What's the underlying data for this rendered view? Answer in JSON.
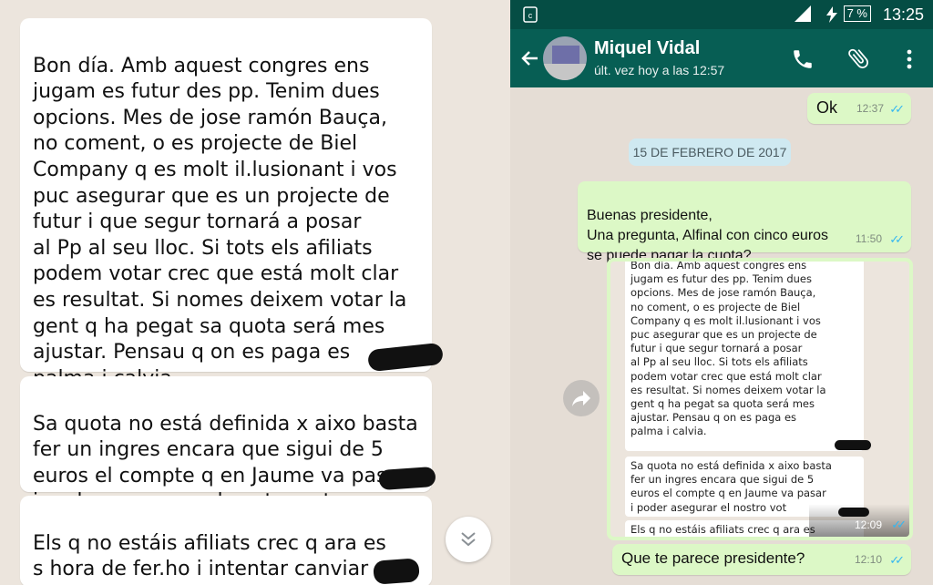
{
  "left": {
    "messages": [
      "Bon día.  Amb aquest congres ens\njugam es futur des pp. Tenim dues\nopcions.   Mes de jose ramón Bauça,\nno coment, o es projecte de Biel\nCompany q es molt il.lusionant i vos\npuc asegurar que es un projecte de\nfutur i que segur tornará a  posar\nal Pp al seu lloc.  Si tots els afiliats\npodem votar crec que está molt clar\nes resultat. Si nomes deixem votar la\ngent q ha pegat sa quota será mes\najustar.  Pensau q on es paga es\npalma i calvia.",
      "Sa quota no está definida x aixo basta\nfer un ingres encara que sigui de 5\neuros el compte q en Jaume va pasar\ni poder asegurar el nostro vot",
      "Els q no estáis afiliats crec q ara es\ns hora de fer.ho i intentar canviar es\npartit amb en biel Company"
    ]
  },
  "status_bar": {
    "time": "13:25",
    "battery": "7 %"
  },
  "header": {
    "contact_name": "Miquel Vidal",
    "last_seen": "últ. vez hoy a las 12:57"
  },
  "chat": {
    "msg_ok": {
      "text": "Ok",
      "time": "12:37"
    },
    "date_chip": "15 DE FEBRERO DE 2017",
    "msg_question": {
      "text": "Buenas presidente,\nUna pregunta,  Alfinal con cinco euros\nse puede pagar la cuota?",
      "time": "11:50"
    },
    "image_msg": {
      "time": "12:09",
      "mini_1": "Bon día.  Amb aquest congres ens\njugam es futur des pp. Tenim dues\nopcions.   Mes de jose ramón Bauça,\nno coment, o es projecte de Biel\nCompany q es molt il.lusionant i vos\npuc asegurar que es un projecte de\nfutur i que segur tornará a  posar\nal Pp al seu lloc.  Si tots els afiliats\npodem votar crec que está molt clar\nes resultat. Si nomes deixem votar la\ngent q ha pegat sa quota será mes\najustar.  Pensau q on es paga es\npalma i calvia.",
      "mini_2": "Sa quota no está definida x aixo basta\nfer un ingres encara que sigui de 5\neuros el compte q en Jaume va pasar\ni poder asegurar el nostro vot",
      "mini_3": "Els q no estáis afiliats crec q ara es"
    },
    "msg_last": {
      "text": "Que te parece presidente?",
      "time": "12:10"
    }
  },
  "colors": {
    "header": "#075e54",
    "status": "#054d44",
    "outgoing": "#dcf8c6",
    "ticks": "#34b7f1"
  }
}
